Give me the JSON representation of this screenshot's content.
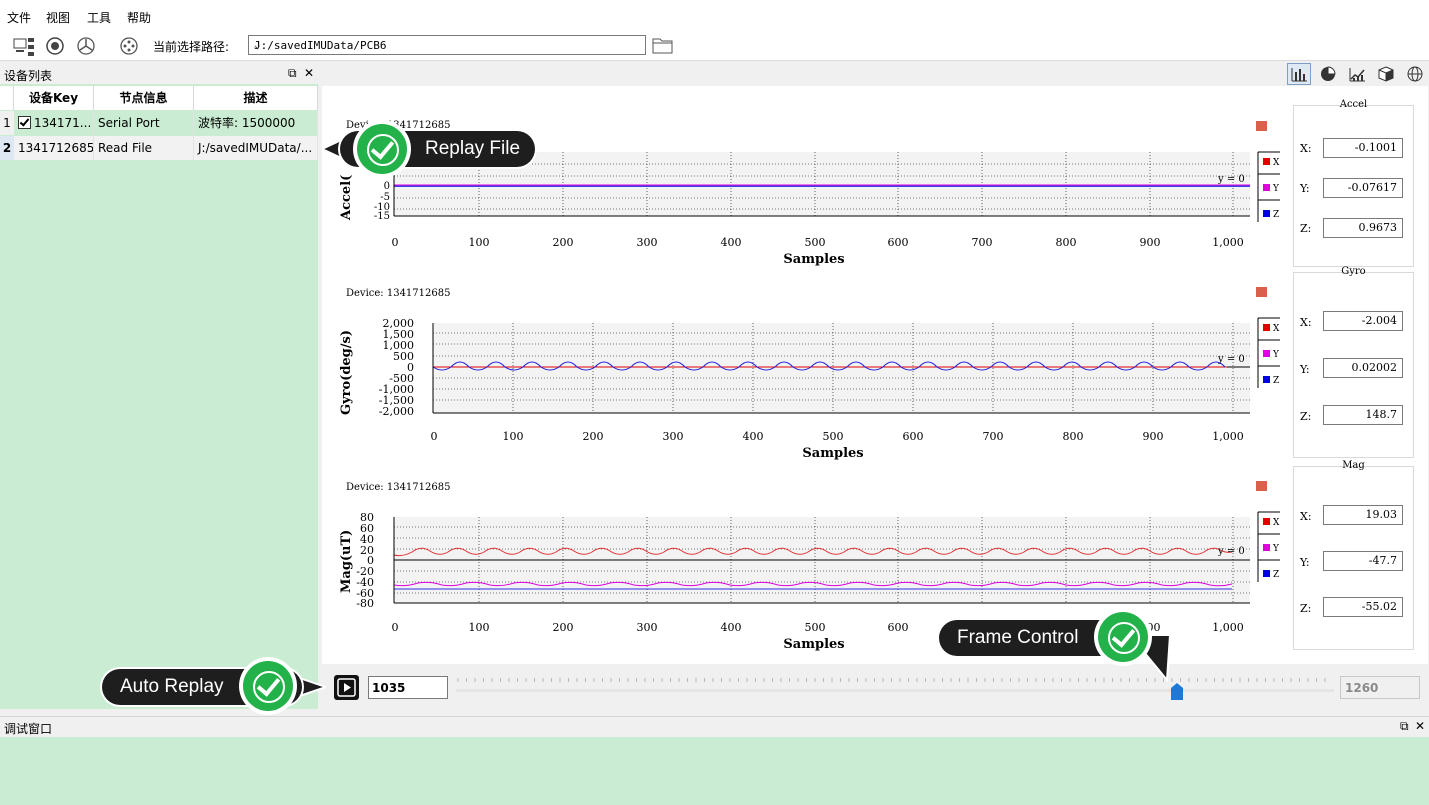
{
  "menu": {
    "file": "文件",
    "view": "视图",
    "tools": "工具",
    "help": "帮助"
  },
  "toolbar": {
    "path_label": "当前选择路径:",
    "path_value": "J:/savedIMUData/PCB6"
  },
  "device_panel": {
    "title": "设备列表",
    "columns": [
      "设备Key",
      "节点信息",
      "描述"
    ],
    "rows": [
      {
        "num": "1",
        "key": "134171...",
        "node": "Serial Port",
        "desc": "波特率: 1500000",
        "checked": true
      },
      {
        "num": "2",
        "key": "1341712685",
        "node": "Read File",
        "desc": "J:/savedIMUData/..."
      }
    ]
  },
  "plots": [
    {
      "device_label": "Device: 1341712685",
      "ylabel": "Accel(",
      "xlabel": "Samples",
      "yline": "y = 0",
      "yticks": [
        "0",
        "-5",
        "-10",
        "-15"
      ],
      "xticks": [
        "0",
        "100",
        "200",
        "300",
        "400",
        "500",
        "600",
        "700",
        "800",
        "900",
        "1,000"
      ],
      "legend": [
        "X",
        "Y",
        "Z"
      ]
    },
    {
      "device_label": "Device: 1341712685",
      "ylabel": "Gyro(deg/s)",
      "xlabel": "Samples",
      "yline": "y = 0",
      "yticks": [
        "2,000",
        "1,500",
        "1,000",
        "500",
        "0",
        "-500",
        "-1,000",
        "-1,500",
        "-2,000"
      ],
      "xticks": [
        "0",
        "100",
        "200",
        "300",
        "400",
        "500",
        "600",
        "700",
        "800",
        "900",
        "1,000"
      ],
      "legend": [
        "X",
        "Y",
        "Z"
      ]
    },
    {
      "device_label": "Device: 1341712685",
      "ylabel": "Mag(uT)",
      "xlabel": "Samples",
      "yline": "y = 0",
      "yticks": [
        "80",
        "60",
        "40",
        "20",
        "0",
        "-20",
        "-40",
        "-60",
        "-80"
      ],
      "xticks": [
        "0",
        "100",
        "200",
        "300",
        "400",
        "500",
        "600",
        "700",
        "800",
        "900",
        "1,000"
      ],
      "legend": [
        "X",
        "Y",
        "Z"
      ]
    }
  ],
  "values": {
    "accel": {
      "title": "Accel",
      "x_label": "X:",
      "y_label": "Y:",
      "z_label": "Z:",
      "x": "-0.1001",
      "y": "-0.07617",
      "z": "0.9673"
    },
    "gyro": {
      "title": "Gyro",
      "x_label": "X:",
      "y_label": "Y:",
      "z_label": "Z:",
      "x": "-2.004",
      "y": "0.02002",
      "z": "148.7"
    },
    "mag": {
      "title": "Mag",
      "x_label": "X:",
      "y_label": "Y:",
      "z_label": "Z:",
      "x": "19.03",
      "y": "-47.7",
      "z": "-55.02"
    }
  },
  "replay": {
    "frame": "1035",
    "total": "1260",
    "progress": 0.821
  },
  "debug": {
    "title": "调试窗口"
  },
  "callouts": {
    "replay_file": "Replay File",
    "auto_replay": "Auto Replay",
    "frame_control": "Frame Control"
  },
  "colors": {
    "x": "#e00000",
    "y": "#e000e0",
    "z": "#0000e0",
    "panel_green": "#c9ecd2",
    "badge_green": "#23b24a"
  }
}
